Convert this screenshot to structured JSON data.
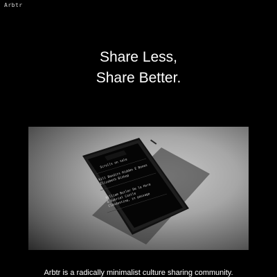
{
  "brand": {
    "name": "Arbtr"
  },
  "hero": {
    "line1": "Share Less,",
    "line2": "Share Better."
  },
  "tagline": "Arbtr is a radically minimalist culture sharing community.",
  "colors": {
    "background": "#000000",
    "text": "#ffffff"
  },
  "phone_screen": {
    "lines": [
      "Scrolls on sale",
      "Kill Bandits Hidden E Bones",
      "Elizabeth Bishop",
      "William Butler De la Hora",
      "& Gabriel Castle",
      "Clandestine, in passage"
    ]
  }
}
